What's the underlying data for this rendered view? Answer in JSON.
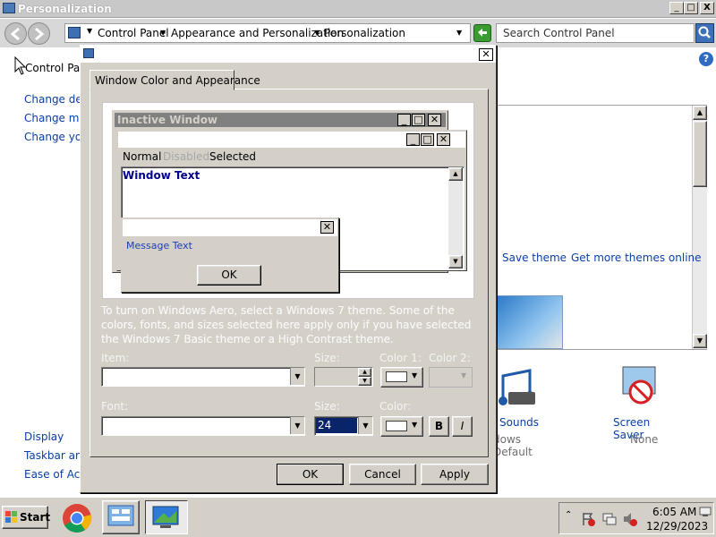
{
  "window": {
    "title": "Personalization",
    "caption_buttons": {
      "minimize": "_",
      "maximize": "□",
      "close": "X"
    }
  },
  "address_bar": {
    "crumbs": [
      "Control Panel",
      "Appearance and Personalization",
      "Personalization"
    ],
    "search_placeholder": "Search Control Panel"
  },
  "left_nav": {
    "home": "Control Panel",
    "links": [
      "Change desk",
      "Change mou",
      "Change your"
    ],
    "see_also": [
      "Display",
      "Taskbar and",
      "Ease of Acce"
    ]
  },
  "themes": {
    "save_theme": "Save theme",
    "get_more": "Get more themes online"
  },
  "bottom_items": [
    {
      "label": "Sounds",
      "sub": "dows Default"
    },
    {
      "label": "Screen Saver",
      "sub": "None"
    }
  ],
  "dialog": {
    "tab": "Window Color and Appearance",
    "preview": {
      "inactive_title": "Inactive Window",
      "menu": [
        "Normal",
        "Disabled",
        "Selected"
      ],
      "window_text": "Window Text",
      "message_text": "Message Text",
      "ok": "OK"
    },
    "info": "To turn on Windows Aero, select a Windows 7 theme.  Some of the colors, fonts, and sizes selected here apply only if you have selected the Windows 7 Basic theme or a High Contrast theme.",
    "item_label": "Item:",
    "size_label": "Size:",
    "color1_label": "Color 1:",
    "color2_label": "Color 2:",
    "font_label": "Font:",
    "font_size_label": "Size:",
    "font_color_label": "Color:",
    "font_size_value": "24",
    "bold": "B",
    "italic": "I",
    "ok": "OK",
    "cancel": "Cancel",
    "apply": "Apply"
  },
  "taskbar": {
    "start": "Start",
    "time": "6:05 AM",
    "date": "12/29/2023"
  },
  "colors": {
    "dialog_bg": "#d4d0c8",
    "inactive_caption": "#808080",
    "link": "#0a3fa5",
    "window_text": "#00008b",
    "selected_field": "#0a246a"
  }
}
